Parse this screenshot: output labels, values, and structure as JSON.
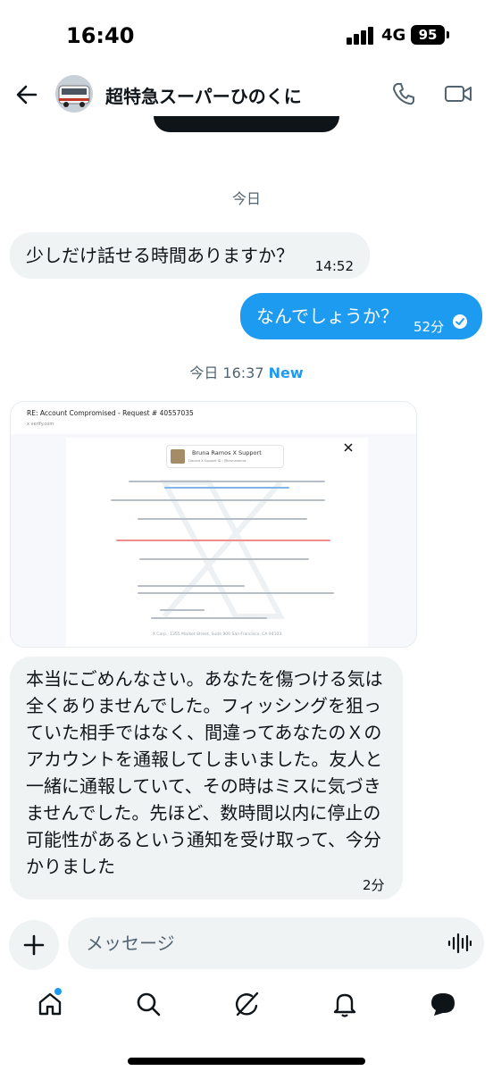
{
  "status_bar": {
    "time": "16:40",
    "network": "4G",
    "battery": "95"
  },
  "header": {
    "title": "超特急スーパーひのくに",
    "back_icon": "back-arrow-icon",
    "call_icon": "phone-icon",
    "video_icon": "video-camera-icon"
  },
  "messages": {
    "date_today": "今日",
    "m1": {
      "text": "少しだけ話せる時間ありますか？",
      "time": "14:52"
    },
    "m2": {
      "text": "なんでしょうか？",
      "time": "52分"
    },
    "new_separator": {
      "label": "今日 16:37",
      "badge": "New"
    },
    "image": {
      "subject": "RE: Account Compromised - Request # 40557035",
      "from": "x verify.com",
      "sender_name": "Bruna Ramos X Support",
      "sender_sub": "Discord X Support ID : @brunaramos",
      "footer": "X Corp., 1355 Market Street, Suite 900 San Francisco, CA 94103"
    },
    "m3": {
      "text": "本当にごめんなさい。あなたを傷つける気は全くありませんでした。フィッシングを狙っていた相手ではなく、間違ってあなたのＸのアカウントを通報してしまいました。友人と一緒に通報していて、その時はミスに気づきませんでした。先ほど、数時間以内に停止の可能性があるという通知を受け取って、今分かりました",
      "time": "2分"
    }
  },
  "composer": {
    "placeholder": "メッセージ"
  },
  "bottom_nav": {
    "items": [
      "home-icon",
      "search-icon",
      "grok-icon",
      "notifications-icon",
      "messages-icon"
    ]
  },
  "colors": {
    "accent": "#1d9bf0",
    "received_bubble": "#eff3f4",
    "text_secondary": "#536471"
  }
}
